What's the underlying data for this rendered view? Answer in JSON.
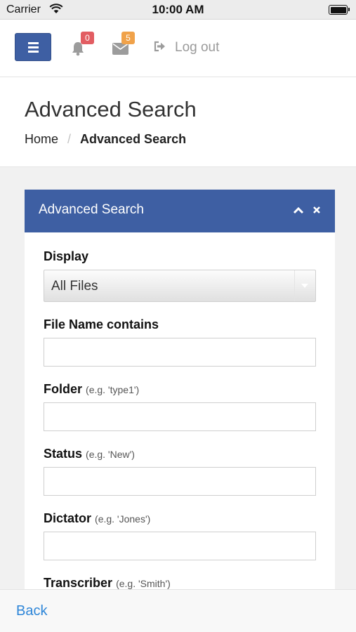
{
  "status_bar": {
    "carrier": "Carrier",
    "time": "10:00 AM"
  },
  "topnav": {
    "notifications_count": "0",
    "messages_count": "5",
    "logout_label": "Log out",
    "colors": {
      "primary": "#3e5fa3",
      "notification_badge": "#e25d62",
      "message_badge": "#f0a24a"
    }
  },
  "header": {
    "title": "Advanced Search",
    "breadcrumb": {
      "home": "Home",
      "separator": "/",
      "current": "Advanced Search"
    }
  },
  "panel": {
    "title": "Advanced Search",
    "display": {
      "label": "Display",
      "selected": "All Files"
    },
    "fields": [
      {
        "label": "File Name contains",
        "hint": "",
        "value": ""
      },
      {
        "label": "Folder",
        "hint": "(e.g. 'type1')",
        "value": ""
      },
      {
        "label": "Status",
        "hint": "(e.g. 'New')",
        "value": ""
      },
      {
        "label": "Dictator",
        "hint": "(e.g. 'Jones')",
        "value": ""
      },
      {
        "label": "Transcriber",
        "hint": "(e.g. 'Smith')",
        "value": ""
      }
    ]
  },
  "bottom_bar": {
    "back_label": "Back"
  }
}
